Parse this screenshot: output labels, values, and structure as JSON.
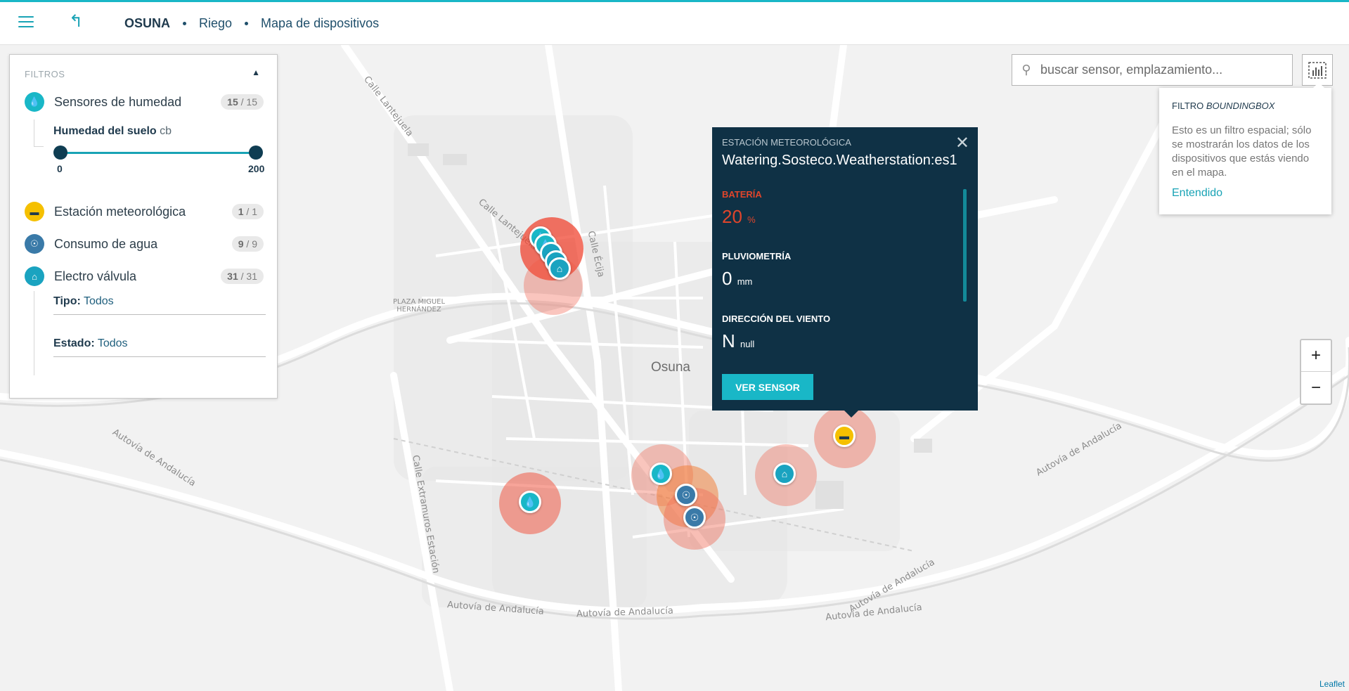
{
  "topbar": {
    "menu_icon": "hamburger-menu-icon",
    "back_icon": "return-arrow-icon",
    "breadcrumbs": [
      "OSUNA",
      "Riego",
      "Mapa de dispositivos"
    ]
  },
  "filters": {
    "title": "FILTROS",
    "collapse_icon": "triangle-up-icon",
    "groups": [
      {
        "label": "Sensores de humedad",
        "count_shown": "15",
        "count_total": "/ 15",
        "icon": "humidity-sensor-icon",
        "color": "#19b7c7"
      },
      {
        "label": "Estación meteorológica",
        "count_shown": "1",
        "count_total": "/ 1",
        "icon": "weather-station-icon",
        "color": "#f5c000"
      },
      {
        "label": "Consumo de agua",
        "count_shown": "9",
        "count_total": "/ 9",
        "icon": "water-tap-icon",
        "color": "#3a7aa8"
      },
      {
        "label": "Electro válvula",
        "count_shown": "31",
        "count_total": "/ 31",
        "icon": "valve-icon",
        "color": "#1aa3c0"
      }
    ],
    "soil_humidity": {
      "label": "Humedad del suelo",
      "unit": "cb",
      "min": "0",
      "max": "200"
    },
    "tipo": {
      "label": "Tipo:",
      "value": "Todos"
    },
    "estado": {
      "label": "Estado:",
      "value": "Todos"
    }
  },
  "search": {
    "placeholder": "buscar sensor, emplazamiento...",
    "value": ""
  },
  "bbox_tip": {
    "title": "FILTRO",
    "title_em": "BOUNDINGBOX",
    "description": "Esto es un filtro espacial; sólo se mostrarán los datos de los dispositivos que estás viendo en el mapa.",
    "ok": "Entendido"
  },
  "popup": {
    "type": "ESTACIÓN METEOROLÓGICA",
    "name": "Watering.Sosteco.Weatherstation:es1",
    "battery": {
      "label": "BATERÍA",
      "value": "20",
      "unit": "%",
      "color": "#e0452b"
    },
    "rain": {
      "label": "PLUVIOMETRÍA",
      "value": "0",
      "unit": "mm"
    },
    "wind": {
      "label": "DIRECCIÓN DEL VIENTO",
      "value": "N",
      "unit": "null"
    },
    "button": "VER SENSOR"
  },
  "map": {
    "city": "Osuna",
    "labels": [
      "Calle Lantejuela",
      "Calle Lantejuela",
      "Calle Écija",
      "PLAZA MIGUEL HERNÁNDEZ",
      "Autovía de Andalucía",
      "Calle Extramuros Estación",
      "Autovía de Andalucía",
      "Autovía de Andalucía",
      "Autovía de Andalucía",
      "Autovía de Andalucía",
      "Autovía de Andalucía"
    ],
    "attribution": "Leaflet",
    "zoom_in": "+",
    "zoom_out": "−"
  }
}
